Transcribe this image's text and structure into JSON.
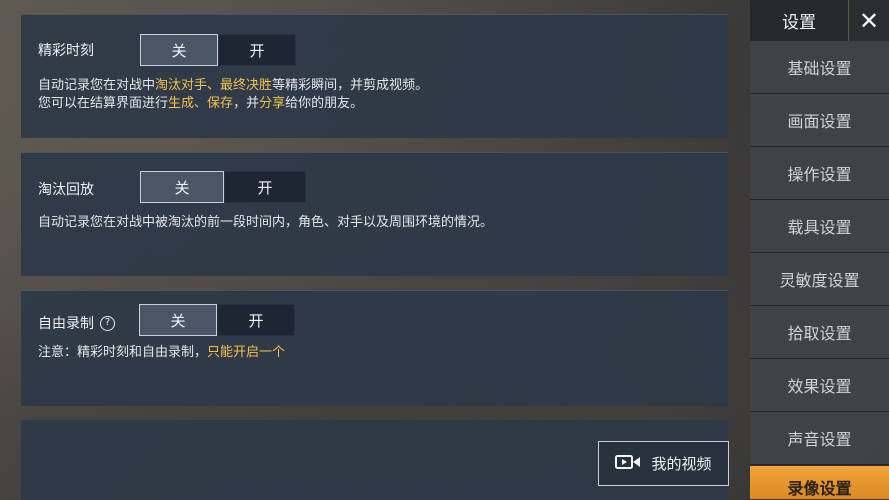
{
  "panels": {
    "highlights": {
      "title": "精彩时刻",
      "off": "关",
      "on": "开",
      "desc_line1": [
        "自动记录您在对战中",
        "淘汰对手",
        "、",
        "最终决胜",
        "等精彩瞬间，并剪成视频。"
      ],
      "desc_line2": [
        "您可以在结算界面进行",
        "生成",
        "、",
        "保存",
        "，并",
        "分享",
        "给你的朋友。"
      ]
    },
    "elimination_replay": {
      "title": "淘汰回放",
      "off": "关",
      "on": "开",
      "desc": "自动记录您在对战中被淘汰的前一段时间内，角色、对手以及周围环境的情况。"
    },
    "free_recording": {
      "title": "自由录制",
      "help": "?",
      "off": "关",
      "on": "开",
      "note_prefix": "注意：精彩时刻和自由录制，",
      "note_highlight": "只能开启一个"
    }
  },
  "my_video_button": {
    "label": "我的视频",
    "icon": "video-camera-icon"
  },
  "sidebar": {
    "title": "设置",
    "close": "✕",
    "items": [
      {
        "label": "基础设置"
      },
      {
        "label": "画面设置"
      },
      {
        "label": "操作设置"
      },
      {
        "label": "载具设置"
      },
      {
        "label": "灵敏度设置"
      },
      {
        "label": "拾取设置"
      },
      {
        "label": "效果设置"
      },
      {
        "label": "声音设置"
      },
      {
        "label": "录像设置",
        "active": true
      }
    ]
  },
  "colors": {
    "highlight": "#f2c24f",
    "active_tab": "#f0a43a",
    "panel_bg": "#2e3848"
  }
}
